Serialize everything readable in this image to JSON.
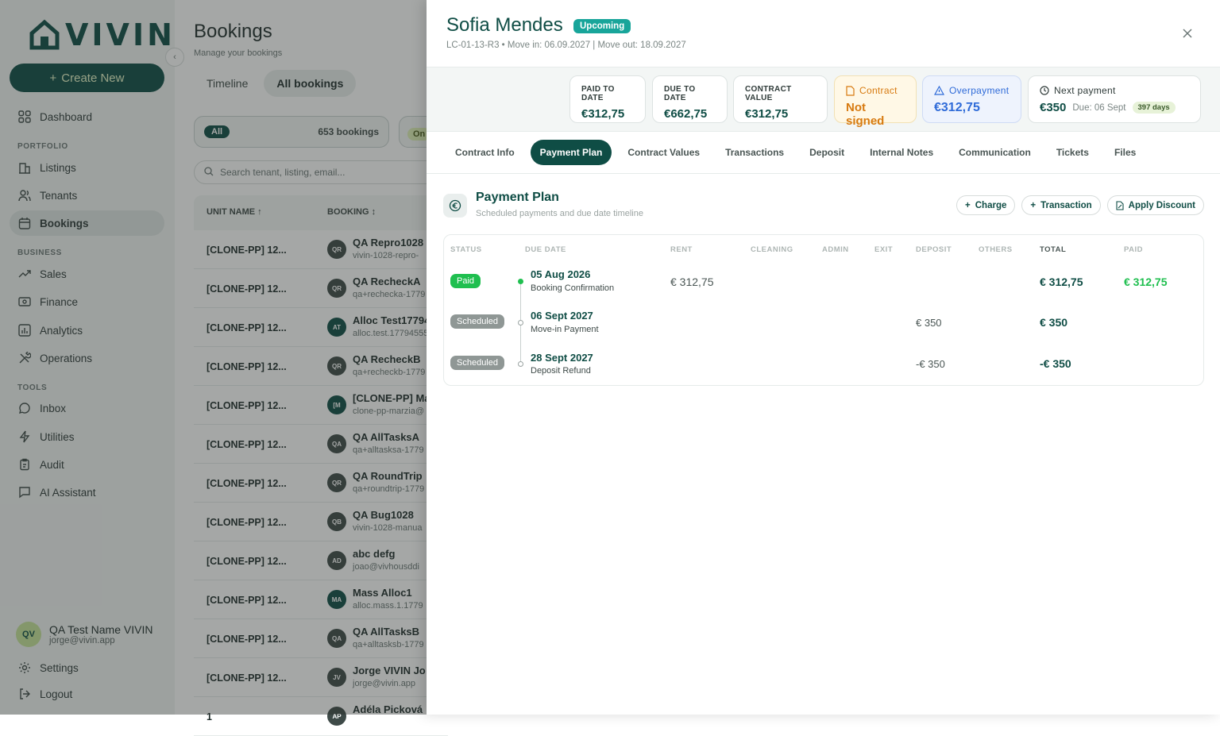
{
  "app": {
    "logo_text": "VIVIN",
    "create_label": "Create New"
  },
  "sidebar": {
    "dashboard": "Dashboard",
    "sections": {
      "portfolio": "PORTFOLIO",
      "business": "BUSINESS",
      "tools": "TOOLS"
    },
    "portfolio": [
      "Listings",
      "Tenants",
      "Bookings"
    ],
    "business": [
      "Sales",
      "Finance",
      "Analytics",
      "Operations"
    ],
    "tools": [
      "Inbox",
      "Utilities",
      "Audit",
      "AI Assistant"
    ],
    "user": {
      "initials": "QV",
      "name": "QA Test Name VIVIN",
      "email": "jorge@vivin.app"
    },
    "settings": "Settings",
    "logout": "Logout"
  },
  "bookings": {
    "title": "Bookings",
    "subtitle": "Manage your bookings",
    "tabs": [
      "Timeline",
      "All bookings"
    ],
    "filter_all": "All",
    "filter_count": "653 bookings",
    "filter_ongoing": "On",
    "search_placeholder": "Search tenant, listing, email...",
    "col_unit": "UNIT NAME",
    "col_booking": "BOOKING",
    "rows": [
      {
        "unit": "[CLONE-PP] 12...",
        "initials": "QR",
        "name": "QA Repro1028",
        "email": "vivin-1028-repro-"
      },
      {
        "unit": "[CLONE-PP] 12...",
        "initials": "QR",
        "name": "QA RecheckA",
        "email": "qa+rechecka-1779"
      },
      {
        "unit": "[CLONE-PP] 12...",
        "initials": "AT",
        "name": "Alloc Test17794",
        "email": "alloc.test.17794555"
      },
      {
        "unit": "[CLONE-PP] 12...",
        "initials": "QR",
        "name": "QA RecheckB",
        "email": "qa+recheckb-1779"
      },
      {
        "unit": "[CLONE-PP] 12...",
        "initials": "[M",
        "name": "[CLONE-PP] Ma",
        "email": "clone-pp-marzia@"
      },
      {
        "unit": "[CLONE-PP] 12...",
        "initials": "QA",
        "name": "QA AllTasksA",
        "email": "qa+alltasksa-1779"
      },
      {
        "unit": "[CLONE-PP] 12...",
        "initials": "QR",
        "name": "QA RoundTrip",
        "email": "qa+roundtrip-1779"
      },
      {
        "unit": "[CLONE-PP] 12...",
        "initials": "QB",
        "name": "QA Bug1028",
        "email": "vivin-1028-manua"
      },
      {
        "unit": "[CLONE-PP] 12...",
        "initials": "AD",
        "name": "abc defg",
        "email": "joao@vivhousddi"
      },
      {
        "unit": "[CLONE-PP] 12...",
        "initials": "MA",
        "name": "Mass Alloc1",
        "email": "alloc.mass.1.1779"
      },
      {
        "unit": "[CLONE-PP] 12...",
        "initials": "QA",
        "name": "QA AllTasksB",
        "email": "qa+alltasksb-1779"
      },
      {
        "unit": "[CLONE-PP] 12...",
        "initials": "JV",
        "name": "Jorge VIVIN Jo",
        "email": "jorge@vivin.app"
      },
      {
        "unit": "1",
        "initials": "AP",
        "name": "Adéla Picková",
        "email": ""
      }
    ]
  },
  "panel": {
    "tenant_name": "Sofia Mendes",
    "status": "Upcoming",
    "meta": "LC-01-13-R3 • Move in: 06.09.2027 | Move out: 18.09.2027",
    "kpis": {
      "paid_label": "PAID TO DATE",
      "paid_value": "€312,75",
      "due_label": "DUE TO DATE",
      "due_value": "€662,75",
      "contract_value_label": "CONTRACT VALUE",
      "contract_value": "€312,75",
      "contract_label": "Contract",
      "contract_status": "Not signed",
      "overpayment_label": "Overpayment",
      "overpayment_value": "€312,75",
      "next_label": "Next payment",
      "next_value": "€350",
      "next_due": "Due: 06 Sept",
      "next_days": "397 days"
    },
    "tabs": [
      "Contract Info",
      "Payment Plan",
      "Contract Values",
      "Transactions",
      "Deposit",
      "Internal Notes",
      "Communication",
      "Tickets",
      "Files"
    ],
    "active_tab": "Payment Plan",
    "plan": {
      "title": "Payment Plan",
      "subtitle": "Scheduled payments and due date timeline",
      "actions": [
        "Charge",
        "Transaction",
        "Apply Discount"
      ],
      "columns": [
        "STATUS",
        "DUE DATE",
        "RENT",
        "CLEANING",
        "ADMIN",
        "EXIT",
        "DEPOSIT",
        "OTHERS",
        "TOTAL",
        "PAID"
      ],
      "rows": [
        {
          "status": "Paid",
          "date": "05 Aug 2026",
          "desc": "Booking Confirmation",
          "rent": "€ 312,75",
          "deposit": "",
          "total": "€ 312,75",
          "paid": "€ 312,75"
        },
        {
          "status": "Scheduled",
          "date": "06 Sept 2027",
          "desc": "Move-in Payment",
          "rent": "",
          "deposit": "€ 350",
          "total": "€ 350",
          "paid": ""
        },
        {
          "status": "Scheduled",
          "date": "28 Sept 2027",
          "desc": "Deposit Refund",
          "rent": "",
          "deposit": "-€ 350",
          "total": "-€ 350",
          "paid": ""
        }
      ]
    }
  },
  "colors": {
    "brand": "#0f4d45",
    "accent": "#18a59a",
    "paid": "#1fbf4f",
    "warning": "#d77a10",
    "info": "#2f6bd8"
  }
}
